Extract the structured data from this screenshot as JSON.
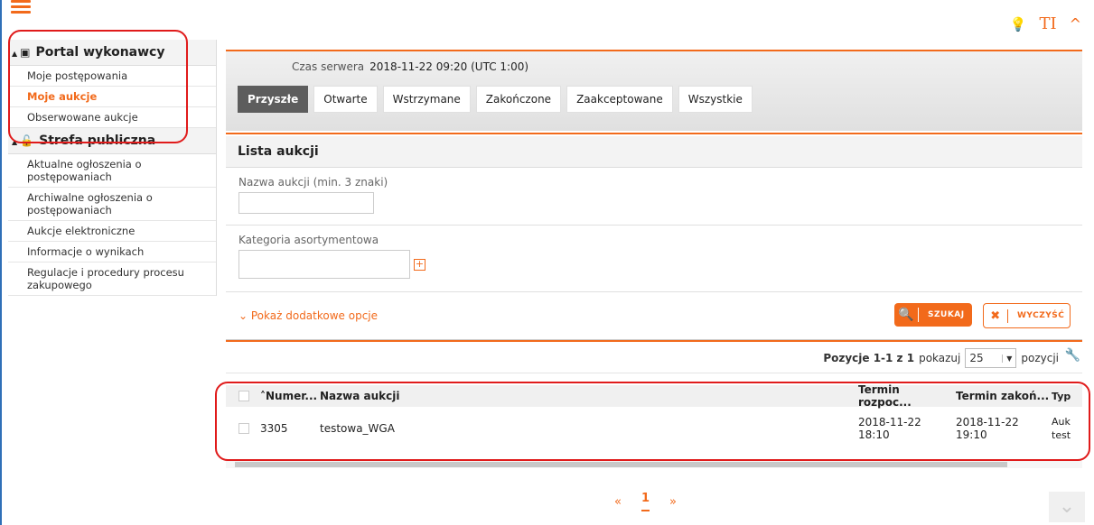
{
  "header": {
    "menu_icon": "hamburger-icon",
    "icons": [
      "lightbulb-icon",
      "text-size-icon",
      "chevron-up-icon"
    ],
    "text_size_glyph": "TI"
  },
  "sidebar": {
    "sections": [
      {
        "title": "Portal wykonawcy",
        "icon": "money-icon",
        "items": [
          {
            "label": "Moje postępowania",
            "active": false
          },
          {
            "label": "Moje aukcje",
            "active": true
          },
          {
            "label": "Obserwowane aukcje",
            "active": false
          }
        ]
      },
      {
        "title": "Strefa publiczna",
        "icon": "unlock-icon",
        "items": [
          {
            "label": "Aktualne ogłoszenia o postępowaniach"
          },
          {
            "label": "Archiwalne ogłoszenia o postępowaniach"
          },
          {
            "label": "Aukcje elektroniczne"
          },
          {
            "label": "Informacje o wynikach"
          },
          {
            "label": "Regulacje i procedury procesu zakupowego"
          }
        ]
      }
    ]
  },
  "main": {
    "server_time_label": "Czas serwera",
    "server_time_value": "2018-11-22 09:20 (UTC 1:00)",
    "tabs": [
      {
        "label": "Przyszłe",
        "active": true
      },
      {
        "label": "Otwarte"
      },
      {
        "label": "Wstrzymane"
      },
      {
        "label": "Zakończone"
      },
      {
        "label": "Zaakceptowane"
      },
      {
        "label": "Wszystkie"
      }
    ],
    "list_title": "Lista aukcji",
    "filters": {
      "name_label": "Nazwa aukcji (min. 3 znaki)",
      "name_value": "",
      "category_label": "Kategoria asortymentowa",
      "category_value": ""
    },
    "more_options": "Pokaż dodatkowe opcje",
    "search_button": "SZUKAJ",
    "clear_button": "WYCZYŚĆ",
    "pager": {
      "positions": "Pozycje 1-1 z 1",
      "show_label": "pokazuj",
      "page_size": "25",
      "suffix": "pozycji"
    },
    "table": {
      "columns": [
        "Numer...",
        "Nazwa aukcji",
        "Termin rozpoc...",
        "Termin zakoń...",
        "Typ"
      ],
      "rows": [
        {
          "numer": "3305",
          "nazwa": "testowa_WGA",
          "start": "2018-11-22 18:10",
          "end": "2018-11-22 19:10",
          "typ": "Auk test"
        }
      ]
    },
    "pagination": {
      "first": "«",
      "current": "1",
      "last": "»"
    },
    "colors": {
      "accent": "#f26a1b",
      "highlight": "#e01b1b"
    }
  }
}
